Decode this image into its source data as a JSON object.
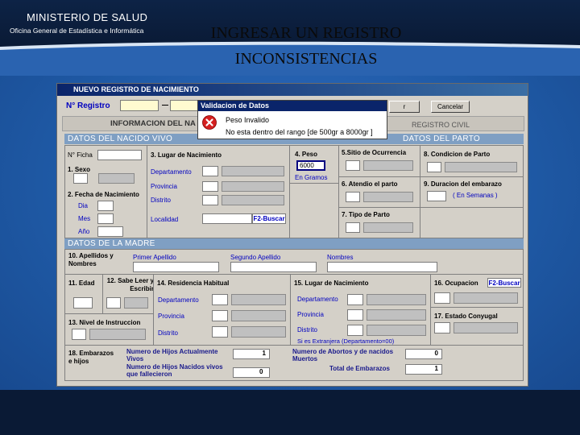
{
  "slide": {
    "org_title": "MINISTERIO DE SALUD",
    "org_subtitle": "Oficina General de Estadística e Informática",
    "title_line1": "INGRESAR UN REGISTRO",
    "title_line2": "INCONSISTENCIAS"
  },
  "app": {
    "window_title": "NUEVO REGISTRO DE NACIMIENTO",
    "n_registro_label": "N° Registro",
    "n_registro_value": "",
    "cancel_label": "Cancelar",
    "accept_label": "r",
    "tab_info": "INFORMACION DEL NA",
    "tab_registro": "REGISTRO CIVIL",
    "f2_buscar": "F2-Buscar"
  },
  "popup": {
    "title": "Validacion de Datos",
    "line1": "Peso Invalido",
    "line2": "No esta dentro del rango [de 500gr a 8000gr ]"
  },
  "nacido": {
    "header": "DATOS DEL NACIDO VIVO",
    "header_right": "DATOS DEL PARTO",
    "n_ficha": "N° Ficha",
    "sexo": "1. Sexo",
    "fecha_nac": "2. Fecha de Nacimiento",
    "dia": "Dia",
    "mes": "Mes",
    "anio": "Año",
    "lugar_nac": "3. Lugar de Nacimiento",
    "departamento": "Departamento",
    "provincia": "Provincia",
    "distrito": "Distrito",
    "localidad": "Localidad",
    "peso": "4. Peso",
    "peso_value": "6000",
    "en_gramos": "En Gramos",
    "sitio": "5.Sitio de Ocurrencia",
    "atendio": "6. Atendio el parto",
    "tipo_parto": "7. Tipo de Parto",
    "condicion": "8. Condicion de Parto",
    "duracion": "9. Duracion del embarazo",
    "en_semanas": "( En Semanas )"
  },
  "madre": {
    "header": "DATOS DE LA MADRE",
    "apellidos": "10. Apellidos y Nombres",
    "primer_apellido": "Primer Apellido",
    "segundo_apellido": "Segundo Apellido",
    "nombres": "Nombres",
    "edad": "11. Edad",
    "sabe_leer": "12. Sabe Leer y Escribir",
    "residencia": "14. Residencia Habitual",
    "departamento": "Departamento",
    "provincia": "Provincia",
    "distrito": "Distrito",
    "nivel_instruccion": "13. Nivel de Instruccion",
    "lugar_nac": "15. Lugar de Nacimiento",
    "extranjera": "Si es Extranjera (Departamento=00)",
    "ocupacion": "16. Ocupacion",
    "estado_conyugal": "17. Estado Conyugal",
    "embarazos": "18. Embarazos e hijos",
    "hijos_vivos": "Numero de Hijos Actualmente Vivos",
    "hijos_vivos_value": "1",
    "hijos_fallecidos": "Numero de Hijos Nacidos vivos que fallecieron",
    "hijos_fallecidos_value": "0",
    "abortos": "Numero de Abortos y de nacidos Muertos",
    "abortos_value": "0",
    "total_embarazos": "Total de Embarazos",
    "total_embarazos_value": "1"
  },
  "colors": {
    "accent_blue": "#1f5aa6",
    "section_bar": "#7f9fc3",
    "error_red": "#d42020"
  }
}
